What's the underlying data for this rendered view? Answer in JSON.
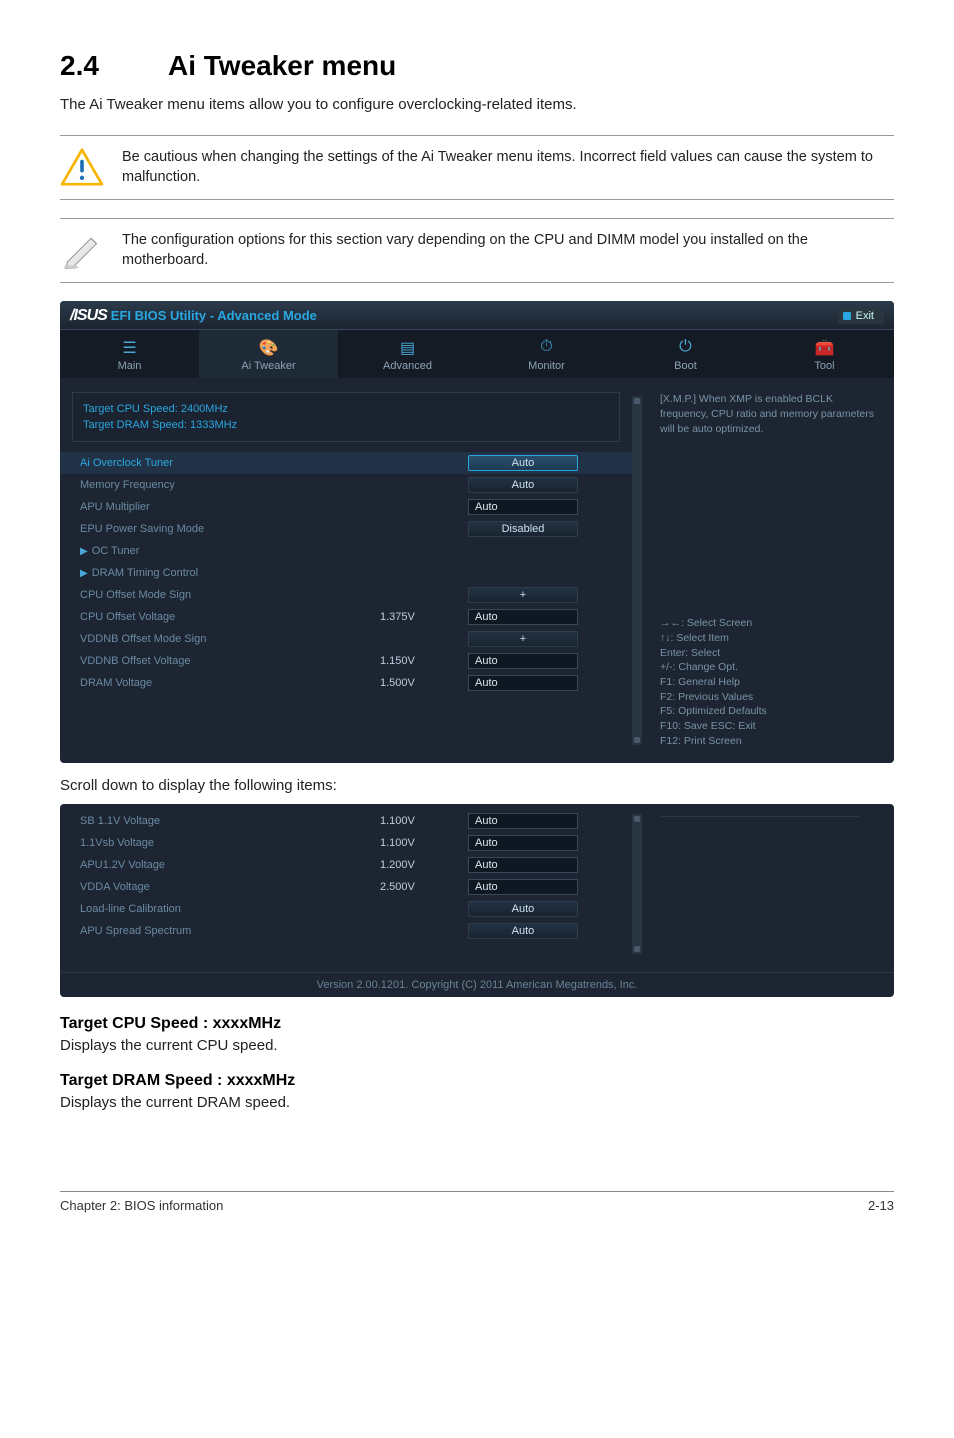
{
  "section": {
    "number": "2.4",
    "title": "Ai Tweaker menu"
  },
  "intro": "The Ai Tweaker menu items allow you to configure overclocking-related items.",
  "warning": "Be cautious when changing the settings of the Ai Tweaker menu items. Incorrect field values can cause the system to malfunction.",
  "note": "The configuration options for this section vary depending on the CPU and DIMM model you installed on the motherboard.",
  "bios": {
    "brand_logo": "/ISUS",
    "product": "EFI BIOS Utility - Advanced Mode",
    "exit": "Exit",
    "tabs": {
      "main": "Main",
      "ai": "Ai  Tweaker",
      "advanced": "Advanced",
      "monitor": "Monitor",
      "boot": "Boot",
      "tool": "Tool"
    },
    "info": {
      "cpu": "Target CPU Speed: 2400MHz",
      "dram": "Target DRAM Speed: 1333MHz"
    },
    "rows": {
      "ai_overclock": {
        "label": "Ai Overclock Tuner",
        "value": "Auto"
      },
      "mem_freq": {
        "label": "Memory Frequency",
        "value": "Auto"
      },
      "apu_mult": {
        "label": "APU Multiplier",
        "value": "Auto"
      },
      "epu": {
        "label": "EPU Power Saving Mode",
        "value": "Disabled"
      },
      "oc_tuner": {
        "label": "OC Tuner"
      },
      "dram_timing": {
        "label": "DRAM Timing Control"
      },
      "cpu_offset_sign": {
        "label": "CPU Offset Mode Sign",
        "value": "+"
      },
      "cpu_offset_v": {
        "label": "CPU Offset Voltage",
        "val": "1.375V",
        "value": "Auto"
      },
      "vddnb_sign": {
        "label": "VDDNB Offset Mode Sign",
        "value": "+"
      },
      "vddnb_v": {
        "label": "VDDNB Offset Voltage",
        "val": "1.150V",
        "value": "Auto"
      },
      "dram_v": {
        "label": "DRAM Voltage",
        "val": "1.500V",
        "value": "Auto"
      }
    },
    "help_top": "[X.M.P.] When XMP is enabled BCLK frequency, CPU ratio and memory parameters will be auto optimized.",
    "help_keys": {
      "l1": "→←:  Select Screen",
      "l2": "↑↓:  Select Item",
      "l3": "Enter:  Select",
      "l4": "+/-:  Change Opt.",
      "l5": "F1:  General Help",
      "l6": "F2:  Previous Values",
      "l7": "F5:  Optimized Defaults",
      "l8": "F10:  Save    ESC:  Exit",
      "l9": "F12:  Print Screen"
    }
  },
  "scrolltext": "Scroll down to display the following items:",
  "bios2": {
    "rows": {
      "sb": {
        "label": "SB 1.1V Voltage",
        "val": "1.100V",
        "value": "Auto"
      },
      "vsb": {
        "label": "1.1Vsb Voltage",
        "val": "1.100V",
        "value": "Auto"
      },
      "apu12": {
        "label": "APU1.2V Voltage",
        "val": "1.200V",
        "value": "Auto"
      },
      "vdda": {
        "label": "VDDA Voltage",
        "val": "2.500V",
        "value": "Auto"
      },
      "llc": {
        "label": "Load-line Calibration",
        "value": "Auto"
      },
      "apu_ss": {
        "label": "APU Spread Spectrum",
        "value": "Auto"
      }
    },
    "footer": "Version  2.00.1201.   Copyright  (C)  2011  American  Megatrends,  Inc."
  },
  "subs": {
    "cpu_h": "Target CPU Speed : xxxxMHz",
    "cpu_p": "Displays the current CPU speed.",
    "dram_h": "Target DRAM Speed : xxxxMHz",
    "dram_p": "Displays the current DRAM speed."
  },
  "page": {
    "chapter": "Chapter 2: BIOS information",
    "num": "2-13"
  }
}
